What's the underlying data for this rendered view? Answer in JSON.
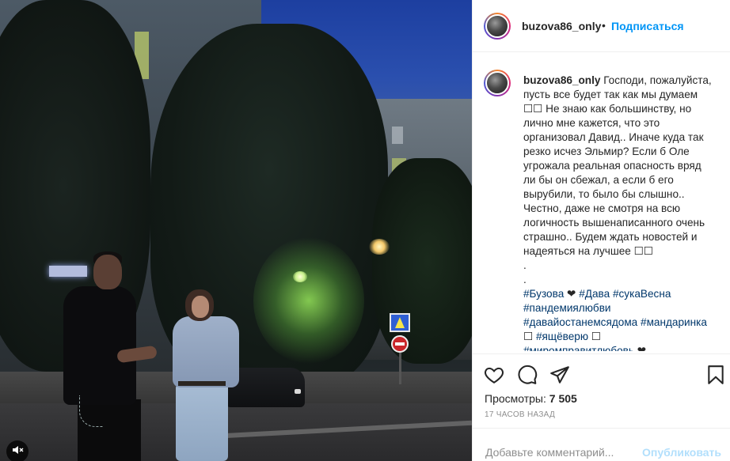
{
  "post": {
    "username": "buzova86_only",
    "dot": "•",
    "follow_label": "Подписаться"
  },
  "caption": {
    "username": "buzova86_only",
    "lines": [
      "Господи, пожалуйста,",
      "пусть все будет так как мы думаем",
      "☐☐ Не знаю как большинству, но",
      "лично мне кажется, что это",
      "организовал Давид.. Иначе куда так",
      "резко исчез Эльмир? Если б Оле",
      "угрожала реальная опасность вряд",
      "ли бы он сбежал, а если б его",
      "вырубили, то было бы слышно..",
      "Честно, даже не смотря на всю",
      "логичность вышенаписанного очень",
      "страшно.. Будем ждать новостей и",
      "надеяться на лучшее ☐☐",
      ".",
      "."
    ],
    "hashtag_lines": [
      [
        "#Бузова",
        " ❤ ",
        "#Дава",
        " ",
        "#сукаВесна"
      ],
      [
        "#пандемиялюбви"
      ],
      [
        "#давайостанемсядома",
        " ",
        "#мандаринка"
      ],
      [
        "☐ ",
        "#ящёверю",
        " ☐"
      ],
      [
        "#миромправитлюбовь",
        " ❤"
      ]
    ]
  },
  "actions": {
    "like_icon": "heart-icon",
    "comment_icon": "comment-icon",
    "share_icon": "share-icon",
    "save_icon": "bookmark-icon"
  },
  "stats": {
    "views_label": "Просмотры:",
    "views_value": "7 505",
    "time_ago": "17 часов назад"
  },
  "comment_box": {
    "placeholder": "Добавьте комментарий...",
    "post_label": "Опубликовать"
  },
  "media": {
    "mute_icon": "speaker-muted-icon"
  }
}
